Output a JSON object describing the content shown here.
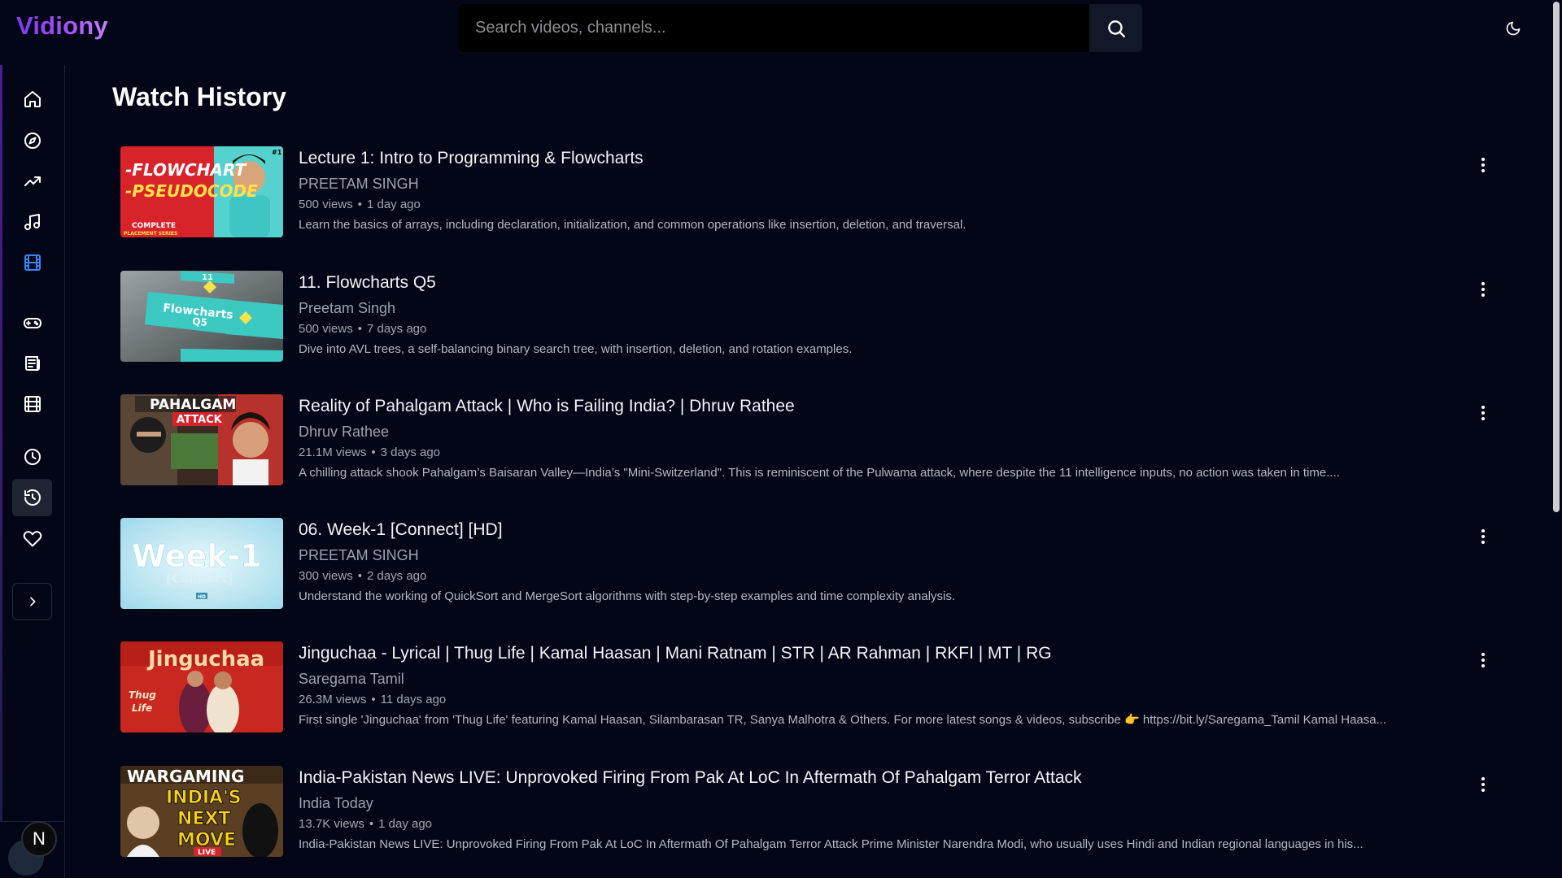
{
  "app": {
    "name": "Vidiony"
  },
  "search": {
    "placeholder": "Search videos, channels..."
  },
  "page": {
    "title": "Watch History"
  },
  "sidebar": {
    "items": [
      {
        "name": "home-icon"
      },
      {
        "name": "compass-icon"
      },
      {
        "name": "trending-icon"
      },
      {
        "name": "music-icon"
      },
      {
        "name": "film-icon",
        "highlight": "#3b82f6"
      },
      {
        "name": "gamepad-icon"
      },
      {
        "name": "newspaper-icon"
      },
      {
        "name": "clapperboard-icon"
      },
      {
        "name": "clock-icon"
      },
      {
        "name": "history-icon",
        "active": true
      },
      {
        "name": "heart-icon"
      }
    ],
    "toggle": {
      "icon": "chevron-right-icon"
    },
    "avatar": {
      "initial": "N"
    }
  },
  "colors": {
    "accent": "#8b5cf6",
    "background": "#030617",
    "active_item": "#1f2533"
  },
  "videos": [
    {
      "title": "Lecture 1: Intro to Programming & Flowcharts",
      "channel": "PREETAM SINGH",
      "views": "500 views",
      "age": "1 day ago",
      "description": "Learn the basics of arrays, including declaration, initialization, and common operations like insertion, deletion, and traversal.",
      "thumb": {
        "line1": "-FLOWCHART",
        "line2": "-PSEUDOCODE",
        "line3": "COMPLETE",
        "line4": "PLACEMENT SERIES",
        "badge": "#1"
      }
    },
    {
      "title": "11. Flowcharts Q5",
      "channel": "Preetam Singh",
      "views": "500 views",
      "age": "7 days ago",
      "description": "Dive into AVL trees, a self-balancing binary search tree, with insertion, deletion, and rotation examples.",
      "thumb": {
        "line1": "Flowcharts",
        "line2": "Q5",
        "line3": "11"
      }
    },
    {
      "title": "Reality of Pahalgam Attack | Who is Failing India? | Dhruv Rathee",
      "channel": "Dhruv Rathee",
      "views": "21.1M views",
      "age": "3 days ago",
      "description": "A chilling attack shook Pahalgam’s Baisaran Valley—India’s \"Mini-Switzerland\". This is reminiscent of the Pulwama attack, where despite the 11 intelligence inputs, no action was taken in time....",
      "thumb": {
        "line1": "PAHALGAM",
        "line2": "ATTACK"
      }
    },
    {
      "title": "06. Week-1 [Connect] [HD]",
      "channel": "PREETAM SINGH",
      "views": "300 views",
      "age": "2 days ago",
      "description": "Understand the working of QuickSort and MergeSort algorithms with step-by-step examples and time complexity analysis.",
      "thumb": {
        "line1": "Week-1",
        "line2": "[Connect]",
        "line3": "HD"
      }
    },
    {
      "title": "Jinguchaa - Lyrical | Thug Life | Kamal Haasan | Mani Ratnam | STR | AR Rahman | RKFI | MT | RG",
      "channel": "Saregama Tamil",
      "views": "26.3M views",
      "age": "11 days ago",
      "description": "First single 'Jinguchaa' from 'Thug Life' featuring Kamal Haasan, Silambarasan TR, Sanya Malhotra & Others. For more latest songs & videos, subscribe 👉 https://bit.ly/Saregama_Tamil Kamal Haasa...",
      "thumb": {
        "line1": "Jinguchaa",
        "line2": "Thug",
        "line3": "Life"
      }
    },
    {
      "title": "India-Pakistan News LIVE: Unprovoked Firing From Pak At LoC In Aftermath Of Pahalgam Terror Attack",
      "channel": "India Today",
      "views": "13.7K views",
      "age": "1 day ago",
      "description": "India-Pakistan News LIVE: Unprovoked Firing From Pak At LoC In Aftermath Of Pahalgam Terror Attack Prime Minister Narendra Modi, who usually uses Hindi and Indian regional languages in his...",
      "thumb": {
        "line1": "WARGAMING",
        "line2": "INDIA'S",
        "line3": "NEXT",
        "line4": "MOVE",
        "line5": "LIVE"
      }
    }
  ]
}
